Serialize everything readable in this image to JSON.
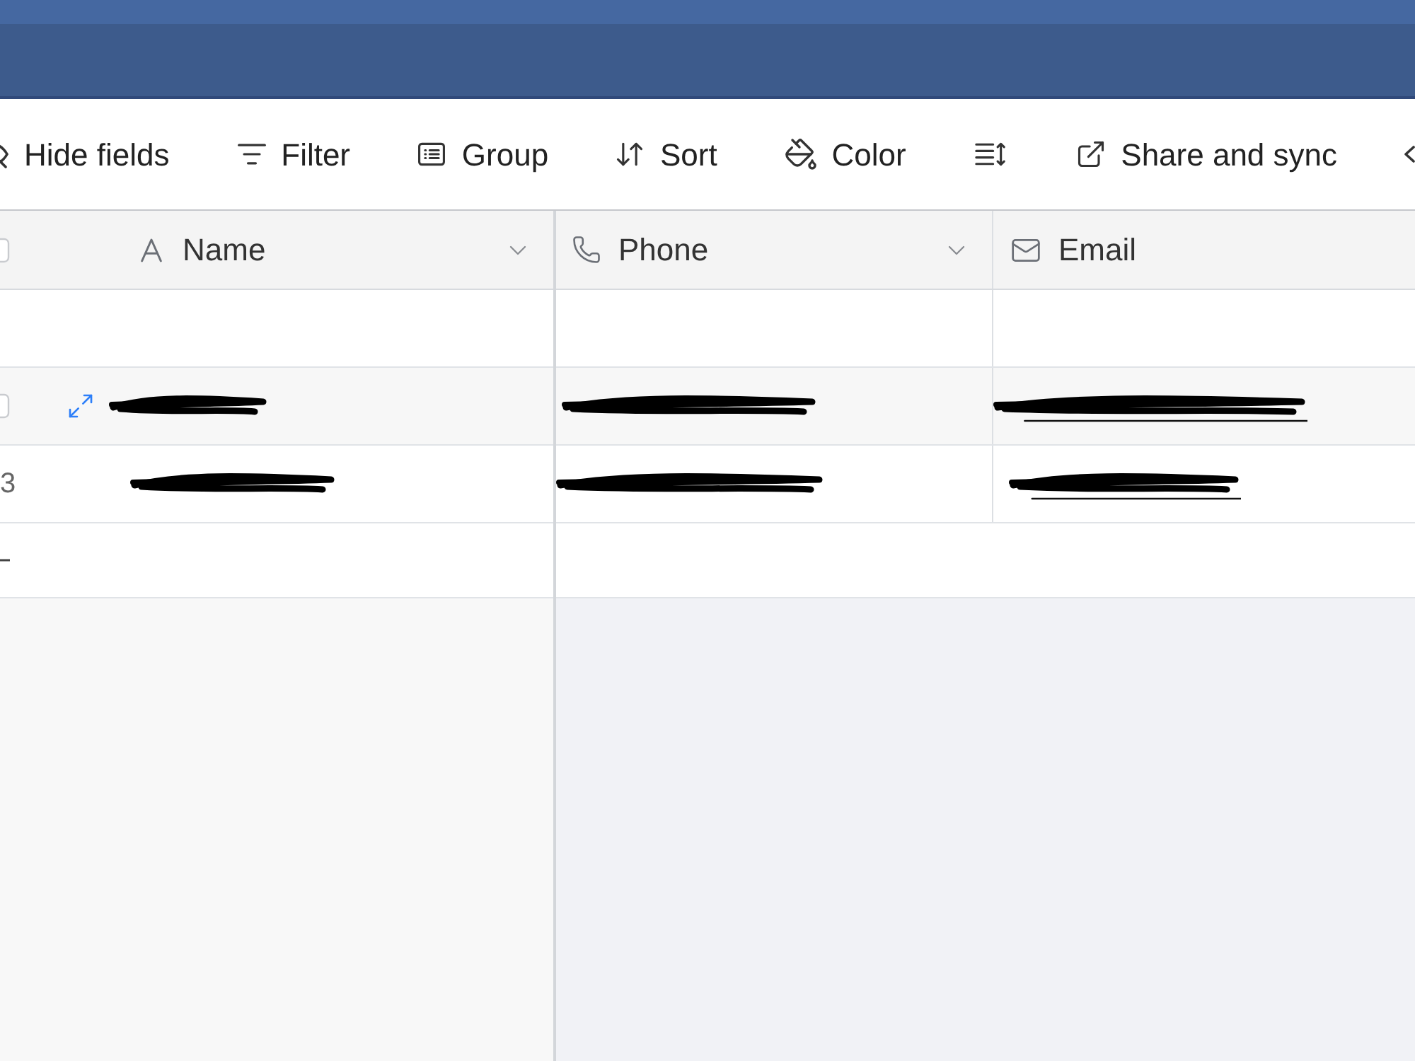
{
  "toolbar": {
    "items": [
      {
        "kind": "hide_fields",
        "label": "Hide fields"
      },
      {
        "kind": "filter",
        "label": "Filter"
      },
      {
        "kind": "group",
        "label": "Group"
      },
      {
        "kind": "sort",
        "label": "Sort"
      },
      {
        "kind": "color",
        "label": "Color"
      },
      {
        "kind": "row_height"
      },
      {
        "kind": "share",
        "label": "Share and sync"
      },
      {
        "kind": "more"
      }
    ]
  },
  "table": {
    "select_all": {
      "checked": false
    },
    "columns": [
      {
        "kind": "text",
        "label": "Name",
        "menu": true
      },
      {
        "kind": "phone",
        "label": "Phone",
        "menu": true
      },
      {
        "kind": "email",
        "label": "Email",
        "menu": false
      }
    ],
    "rows": [
      {
        "hovered": false,
        "cells": [
          {
            "redacted": false
          },
          {
            "redacted": false
          },
          {
            "redacted": false
          }
        ]
      },
      {
        "hovered": true,
        "checked": false,
        "cells": [
          {
            "redacted": true
          },
          {
            "redacted": true
          },
          {
            "redacted": true
          }
        ]
      },
      {
        "hovered": false,
        "number": "3",
        "cells": [
          {
            "redacted": true
          },
          {
            "redacted": true
          },
          {
            "redacted": true
          }
        ]
      }
    ],
    "add_row": true
  }
}
